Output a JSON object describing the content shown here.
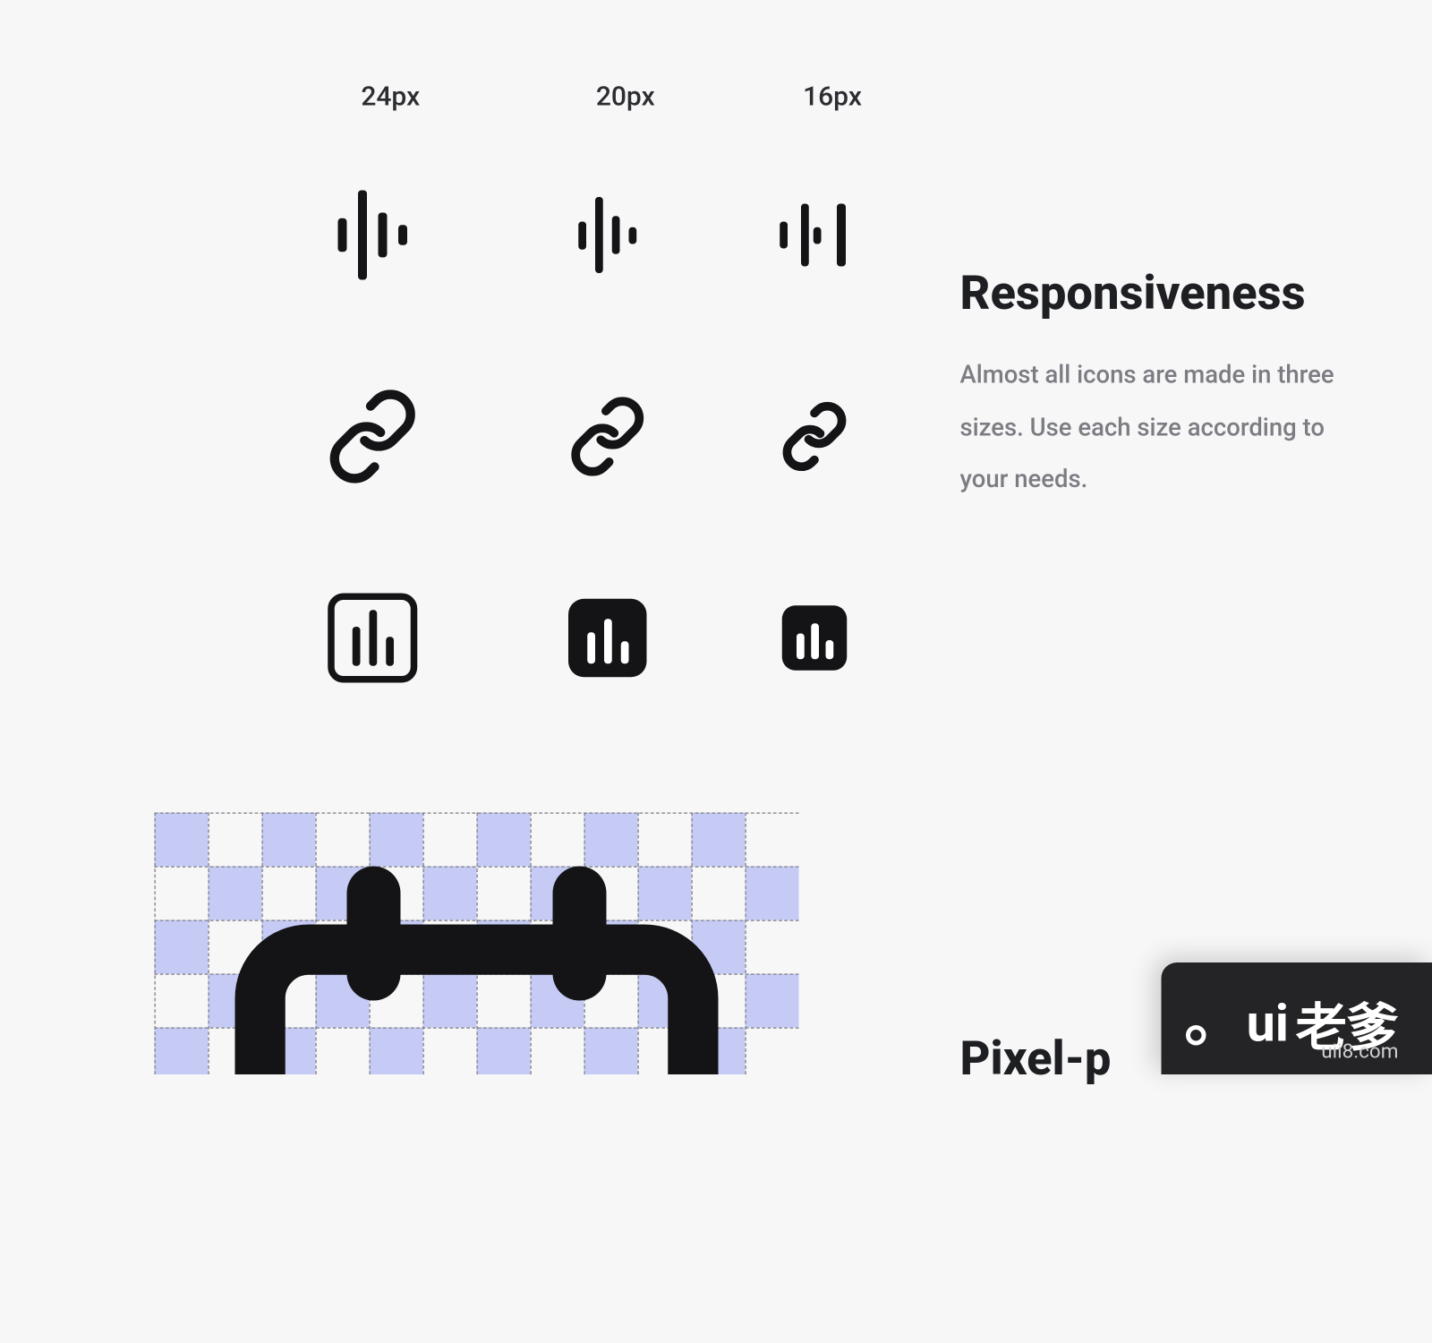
{
  "sizes": {
    "s1": "24px",
    "s2": "20px",
    "s3": "16px"
  },
  "section1": {
    "title": "Responsiveness",
    "desc": "Almost all icons are made in three sizes. Use each size according to your needs."
  },
  "section2": {
    "title": "Pixel-p"
  },
  "watermark": {
    "logo": "ui",
    "cn": "老爹",
    "url": "uii8.com"
  }
}
